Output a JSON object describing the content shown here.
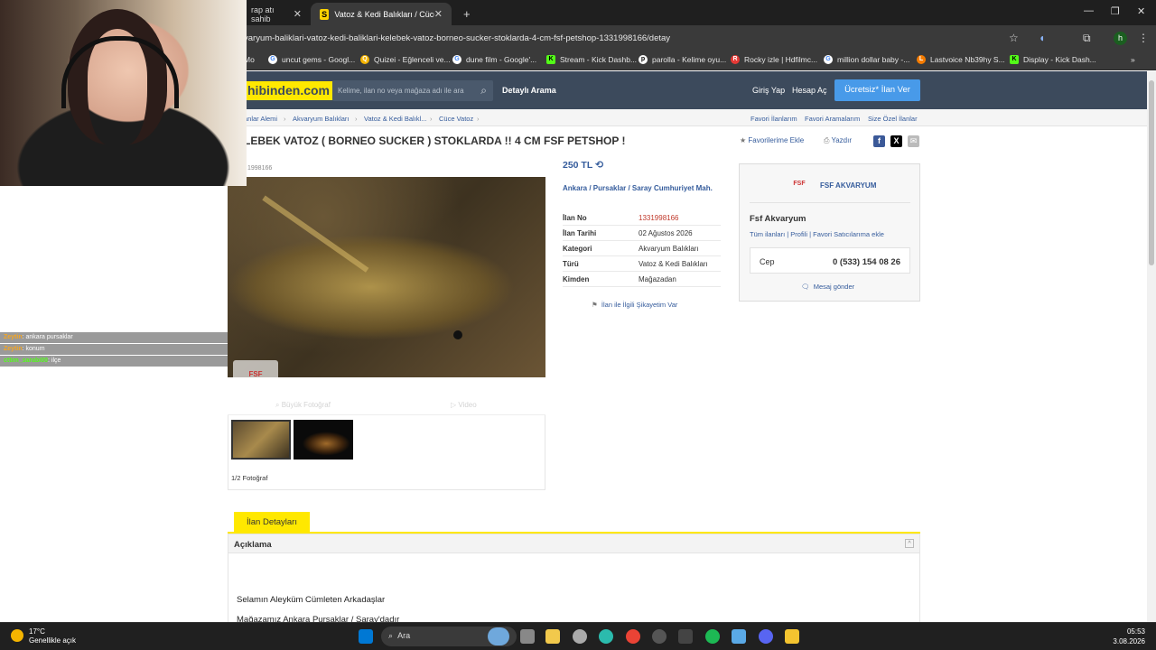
{
  "browser": {
    "tabs": [
      {
        "label": "rap atı sahib",
        "active": false
      },
      {
        "label": "Vatoz & Kedi Balıkları / Cüce Va",
        "active": true
      }
    ],
    "new_tab": "+",
    "url": "varyum-baliklari-vatoz-kedi-baliklari-kelebek-vatoz-borneo-sucker-stoklarda-4-cm-fsf-petshop-1331998166/detay",
    "profile_initial": "h",
    "bookmarks": [
      "uncut gems - Googl...",
      "Quizei - Eğlenceli ve...",
      "dune film - Google'...",
      "Stream - Kick Dashb...",
      "parolla - Kelime oyu...",
      "Rocky izle | Hdfilmc...",
      "million dollar baby -...",
      "Lastvoice Nb39hy S...",
      "Display - Kick Dash..."
    ],
    "bookmark_partial": "Mo"
  },
  "site": {
    "logo": "hibinden.com",
    "search_placeholder": "Kelime, ilan no veya mağaza adı ile ara",
    "detailed_search": "Detaylı Arama",
    "login": "Giriş Yap",
    "register": "Hesap Aç",
    "post_ad": "Ücretsiz* İlan Ver",
    "breadcrumbs": [
      "anlar Alemi",
      "Akvaryum Balıkları",
      "Vatoz & Kedi Balıkl...",
      "Cüce Vatoz"
    ],
    "top_links": [
      "Favori İlanlarım",
      "Favori Aramalarım",
      "Size Özel İlanlar"
    ]
  },
  "listing": {
    "title": "LEBEK VATOZ ( BORNEO SUCKER ) STOKLARDA !! 4 CM FSF PETSHOP !",
    "add_favorite": "Favorilerime Ekle",
    "print": "Yazdır",
    "social": [
      "f",
      "X",
      "✉"
    ],
    "id_partial": "1998166",
    "price": "250 TL",
    "location": "Ankara  /  Pursaklar  /  Saray Cumhuriyet Mah.",
    "details": [
      {
        "key": "İlan No",
        "value": "1331998166"
      },
      {
        "key": "İlan Tarihi",
        "value": "02 Ağustos 2026"
      },
      {
        "key": "Kategori",
        "value": "Akvaryum Balıkları"
      },
      {
        "key": "Türü",
        "value": "Vatoz & Kedi Balıkları"
      },
      {
        "key": "Kimden",
        "value": "Mağazadan"
      }
    ],
    "complaint": "İlan ile İlgili Şikayetim Var",
    "gallery_large": "Büyük Fotoğraf",
    "gallery_video": "Video",
    "photo_count": "1/2 Fotoğraf",
    "watermark": "FSF"
  },
  "seller": {
    "store": "FSF AKVARYUM",
    "name": "Fsf Akvaryum",
    "links": "Tüm ilanları  |  Profili  |  Favori Satıcılarıma ekle",
    "phone_label": "Cep",
    "phone": "0 (533) 154 08 26",
    "message": "Mesaj gönder"
  },
  "details_tab": {
    "tab": "İlan Detayları",
    "section": "Açıklama",
    "line1": "Selamın Aleyküm Cümleten Arkadaşlar",
    "line2": "Mağazamız Ankara Pursaklar / Saray'dadır"
  },
  "stream_chat": [
    {
      "user": "Zeytin",
      "text": "ankara pursaklar"
    },
    {
      "user": "Zeytin",
      "text": "konum"
    },
    {
      "user": "cttim_sarabi00",
      "text": "ilçe"
    }
  ],
  "taskbar": {
    "temp": "17°C",
    "weather": "Genellikle açık",
    "search": "Ara",
    "time": "05:53",
    "date": "3.08.2026"
  }
}
